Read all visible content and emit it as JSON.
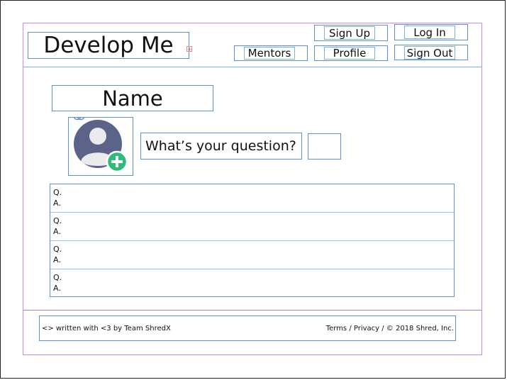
{
  "header": {
    "brand": "Develop Me",
    "nav": {
      "signup": "Sign Up",
      "login": "Log In",
      "mentors": "Mentors",
      "profile": "Profile",
      "signout": "Sign Out"
    }
  },
  "profile": {
    "name": "Name",
    "question_placeholder": "What’s your question?"
  },
  "qa": [
    {
      "q": "Q.",
      "a": "A."
    },
    {
      "q": "Q.",
      "a": "A."
    },
    {
      "q": "Q.",
      "a": "A."
    },
    {
      "q": "Q.",
      "a": "A."
    }
  ],
  "footer": {
    "left": "<> written with <3 by Team ShredX",
    "right": "Terms / Privacy / © 2018 Shred, Inc."
  },
  "colors": {
    "outline_purple": "#c58ce6",
    "outline_blue": "#5a8fd0",
    "avatar": "#5b6388",
    "plus_badge": "#2ebd76"
  }
}
